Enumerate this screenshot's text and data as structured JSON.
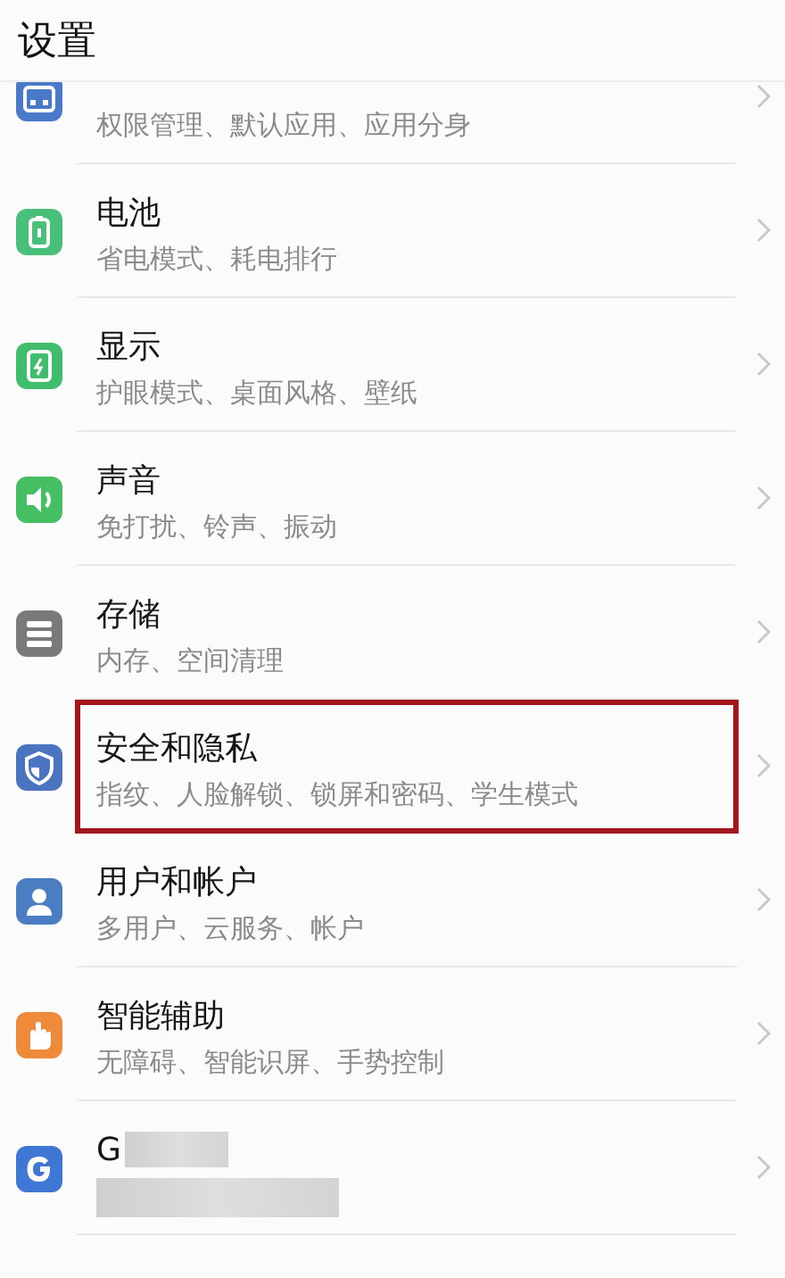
{
  "header": {
    "title": "设置"
  },
  "items": [
    {
      "kind": "apps",
      "subtitle": "权限管理、默认应用、应用分身",
      "highlighted": false
    },
    {
      "kind": "battery",
      "title": "电池",
      "subtitle": "省电模式、耗电排行",
      "highlighted": false
    },
    {
      "kind": "display",
      "title": "显示",
      "subtitle": "护眼模式、桌面风格、壁纸",
      "highlighted": false
    },
    {
      "kind": "sound",
      "title": "声音",
      "subtitle": "免打扰、铃声、振动",
      "highlighted": false
    },
    {
      "kind": "storage",
      "title": "存储",
      "subtitle": "内存、空间清理",
      "highlighted": false
    },
    {
      "kind": "security",
      "title": "安全和隐私",
      "subtitle": "指纹、人脸解锁、锁屏和密码、学生模式",
      "highlighted": true
    },
    {
      "kind": "users",
      "title": "用户和帐户",
      "subtitle": "多用户、云服务、帐户",
      "highlighted": false
    },
    {
      "kind": "accessibility",
      "title": "智能辅助",
      "subtitle": "无障碍、智能识屏、手势控制",
      "highlighted": false
    },
    {
      "kind": "google",
      "title": "G",
      "redacted": true,
      "highlighted": false
    }
  ]
}
